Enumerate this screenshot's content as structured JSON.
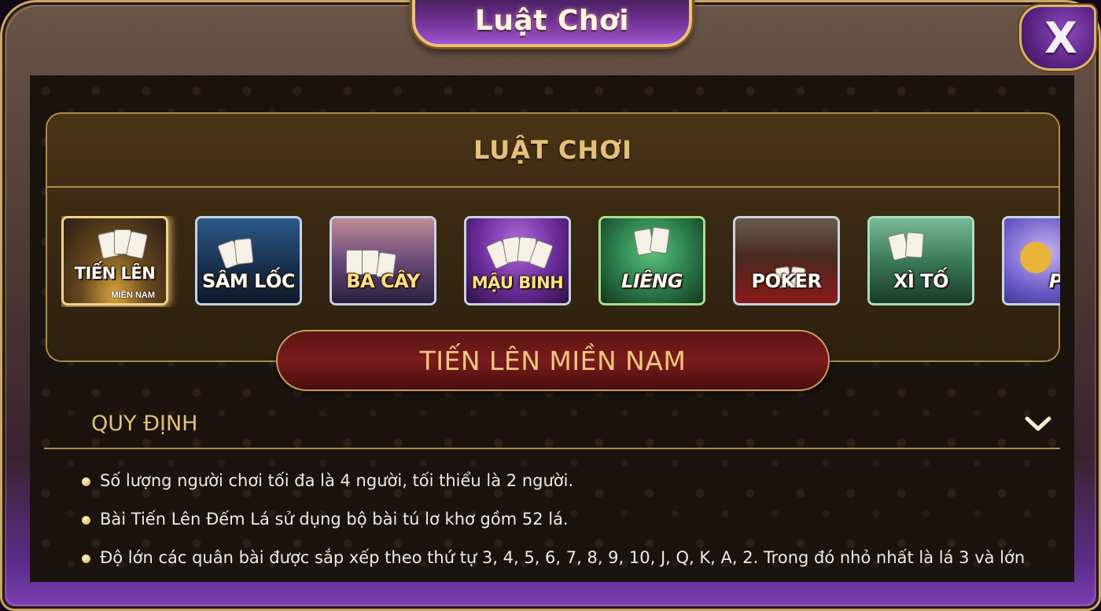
{
  "window": {
    "title": "Luật Chơi",
    "close_label": "X"
  },
  "selector": {
    "header": "LUẬT CHƠI"
  },
  "games": [
    {
      "label": "TIẾN LÊN",
      "sub": "MIỀN NAM",
      "selected": true
    },
    {
      "label": "SÂM LỐC"
    },
    {
      "label": "BA CÂY"
    },
    {
      "label": "MẬU BINH"
    },
    {
      "label": "LIÊNG"
    },
    {
      "label": "POKER"
    },
    {
      "label": "XÌ TỐ"
    },
    {
      "label": "PHỎ"
    }
  ],
  "selected_game": "TIẾN LÊN MIỀN NAM",
  "rules": {
    "title": "QUY ĐỊNH",
    "items": [
      "Số lượng người chơi tối đa là 4 người, tối thiểu là 2 người.",
      "Bài Tiến Lên Đếm Lá sử dụng bộ bài tú lơ khơ gồm 52 lá.",
      "Độ lớn các quân bài được sắp xếp theo thứ tự 3, 4, 5, 6, 7, 8, 9, 10, J, Q, K, A, 2. Trong đó nhỏ nhất là lá 3 và lớn"
    ]
  },
  "colors": {
    "gold": "#e5c07a",
    "panel": "#3a2912",
    "banner": "#7a1c1c",
    "accent_purple": "#6b2e8e"
  },
  "icons": {
    "close": "close-icon",
    "expand": "chevron-down-icon",
    "bullet": "bullet-dot-icon"
  }
}
